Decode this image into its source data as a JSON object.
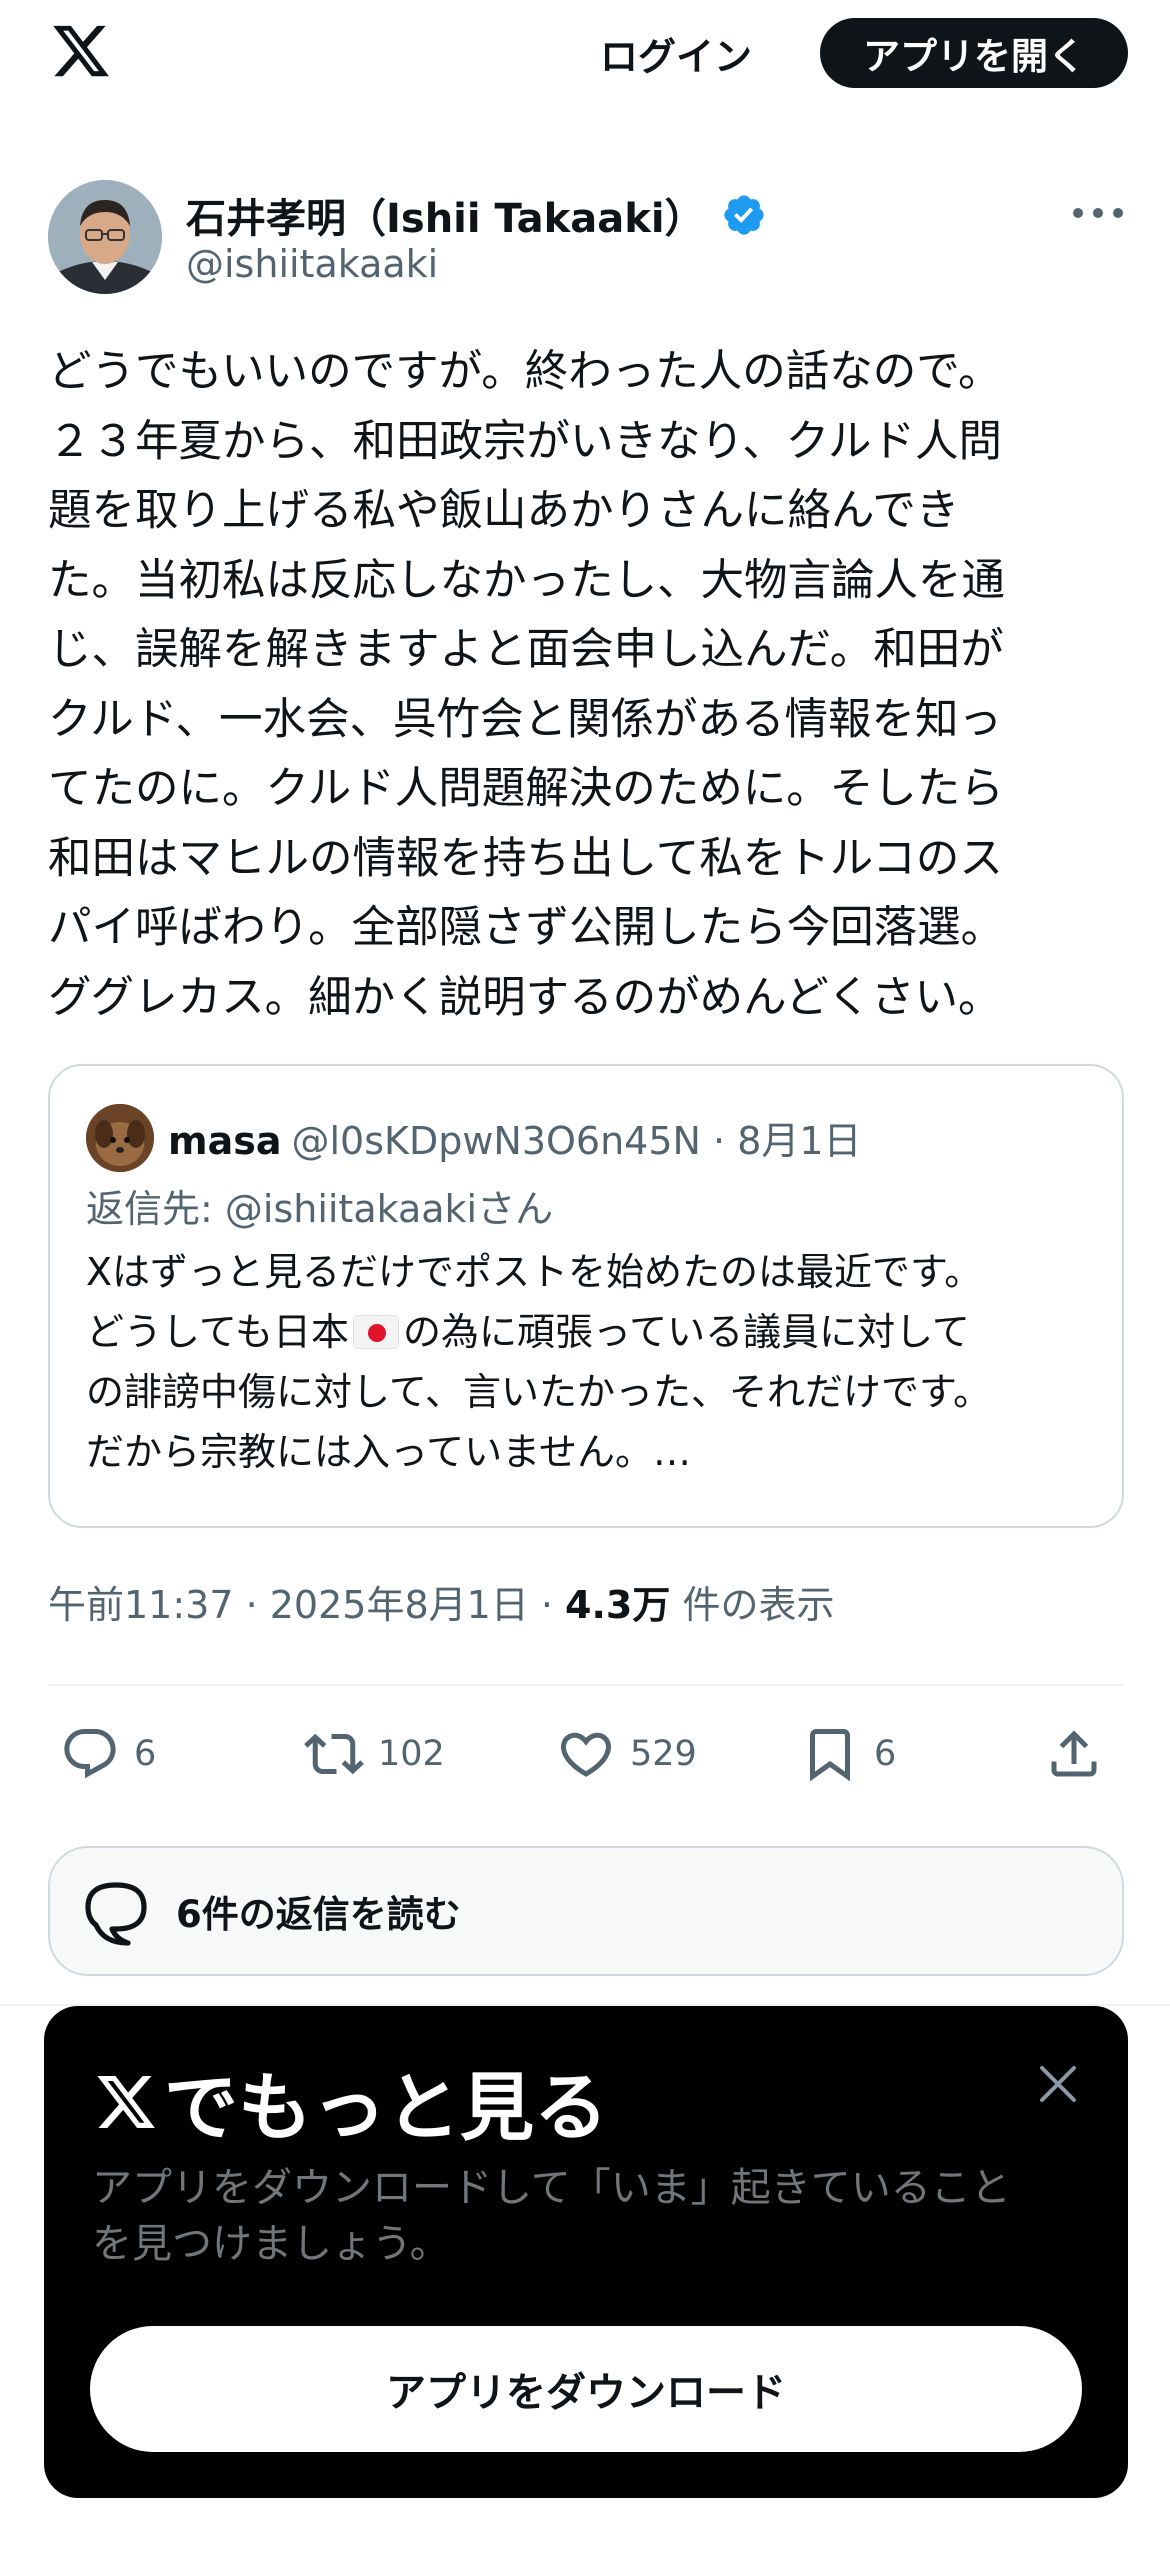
{
  "header": {
    "logo_icon": "x-logo-icon",
    "login_label": "ログイン",
    "open_app_label": "アプリを開く"
  },
  "author": {
    "display_name": "石井孝明（Ishii Takaaki）",
    "handle": "@ishiitakaaki",
    "verified_color": "#1d9bf0"
  },
  "tweet": {
    "text": "どうでもいいのですが。終わった人の話なので。\n２３年夏から、和田政宗がいきなり、クルド人問\n題を取り上げる私や飯山あかりさんに絡んでき\nた。当初私は反応しなかったし、大物言論人を通\nじ、誤解を解きますよと面会申し込んだ。和田が\nクルド、一水会、呉竹会と関係がある情報を知っ\nてたのに。クルド人問題解決のために。そしたら\n和田はマヒルの情報を持ち出して私をトルコのス\nパイ呼ばわり。全部隠さず公開したら今回落選。\nググレカス。細かく説明するのがめんどくさい。"
  },
  "quote": {
    "name": "masa",
    "meta": "@l0sKDpwN3O6n45N · 8月1日",
    "reply_to": "返信先: @ishiitakaakiさん",
    "line1": "Xはずっと見るだけでポストを始めたのは最近です。",
    "line2_before_flag": "どうしても日本",
    "line2_after_flag": "の為に頑張っている議員に対して",
    "line3": "の誹謗中傷に対して、言いたかった、それだけです。",
    "line4": "だから宗教には入っていません。…"
  },
  "timestamp": {
    "time_date": "午前11:37 · 2025年8月1日 · ",
    "views_count": "4.3万",
    "views_label": " 件の表示"
  },
  "actions": {
    "replies": "6",
    "reposts": "102",
    "likes": "529",
    "bookmarks": "6"
  },
  "read_replies_label": "6件の返信を読む",
  "promo": {
    "title": "でもっと見る",
    "description": "アプリをダウンロードして「いま」起きていること\nを見つけましょう。",
    "download_label": "アプリをダウンロード"
  }
}
